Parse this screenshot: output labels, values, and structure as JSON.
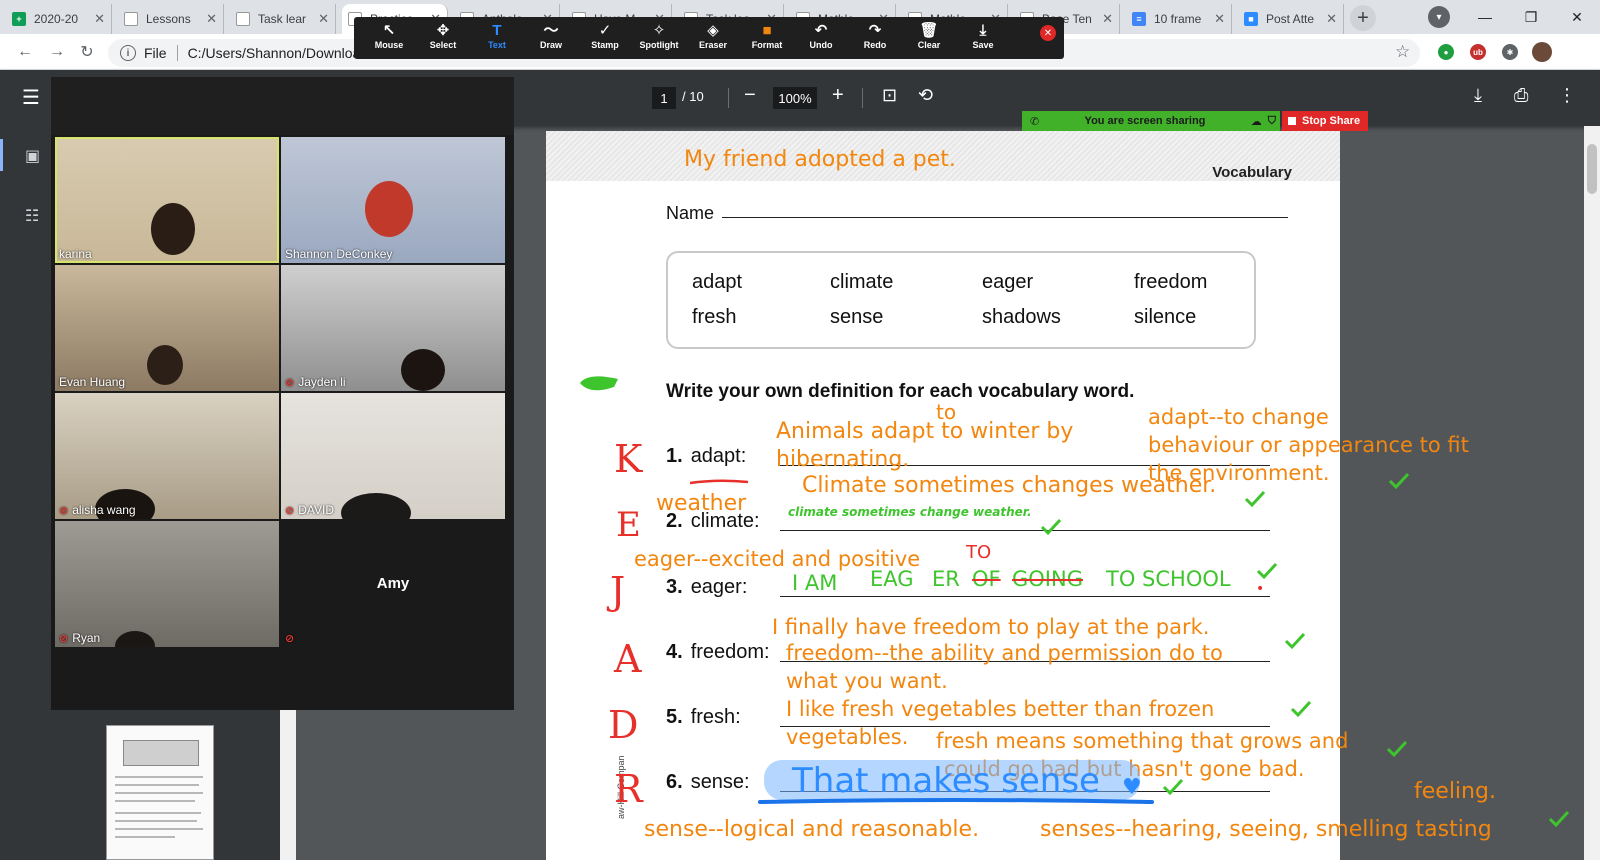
{
  "browser": {
    "tabs": [
      {
        "title": "2020-20",
        "color": "#0f9d58",
        "glyph": "+"
      },
      {
        "title": "Lessons",
        "color": "#ffffff",
        "glyph": ""
      },
      {
        "title": "Task lear",
        "color": "#ffffff",
        "glyph": ""
      },
      {
        "title": "Practice",
        "color": "#ffffff",
        "glyph": ""
      },
      {
        "title": "Antholo",
        "color": "#ffffff",
        "glyph": ""
      },
      {
        "title": "Have M",
        "color": "#ffffff",
        "glyph": ""
      },
      {
        "title": "Task lea",
        "color": "#ffffff",
        "glyph": ""
      },
      {
        "title": "Mathle",
        "color": "#ffffff",
        "glyph": ""
      },
      {
        "title": "Mathle",
        "color": "#ffffff",
        "glyph": ""
      },
      {
        "title": "Base Ten",
        "color": "#ffffff",
        "glyph": ""
      },
      {
        "title": "10 frame",
        "color": "#4285f4",
        "glyph": "≡"
      },
      {
        "title": "Post Atte",
        "color": "#2d8cff",
        "glyph": "■"
      }
    ],
    "address": {
      "scheme": "File",
      "path": "C:/Users/Shannon/Downloads"
    }
  },
  "annotation_toolbar": {
    "tools": [
      {
        "label": "Mouse",
        "icon": "↖",
        "icon_name": "mouse-icon"
      },
      {
        "label": "Select",
        "icon": "✥",
        "icon_name": "select-icon"
      },
      {
        "label": "Text",
        "icon": "T",
        "icon_name": "text-icon"
      },
      {
        "label": "Draw",
        "icon": "〜",
        "icon_name": "draw-icon"
      },
      {
        "label": "Stamp",
        "icon": "✓",
        "icon_name": "stamp-icon"
      },
      {
        "label": "Spotlight",
        "icon": "✧",
        "icon_name": "spotlight-icon"
      },
      {
        "label": "Eraser",
        "icon": "◈",
        "icon_name": "eraser-icon"
      },
      {
        "label": "Format",
        "icon": "■",
        "icon_name": "format-icon"
      },
      {
        "label": "Undo",
        "icon": "↶",
        "icon_name": "undo-icon"
      },
      {
        "label": "Redo",
        "icon": "↷",
        "icon_name": "redo-icon"
      },
      {
        "label": "Clear",
        "icon": "🗑",
        "icon_name": "trash-icon"
      },
      {
        "label": "Save",
        "icon": "⤓",
        "icon_name": "save-icon"
      }
    ],
    "active_tool": "Text",
    "active_color": "#2d8cff",
    "format_color": "#f2860f"
  },
  "pdf_toolbar": {
    "page_current": "1",
    "page_total": "/ 10",
    "zoom": "100%"
  },
  "screen_share": {
    "status": "You are screen sharing",
    "stop_label": "Stop Share"
  },
  "participants": [
    {
      "name": "karina",
      "muted": false,
      "speaking": true
    },
    {
      "name": "Shannon DeConkey",
      "muted": false,
      "speaking": false
    },
    {
      "name": "Evan Huang",
      "muted": false,
      "speaking": false
    },
    {
      "name": "Jayden li",
      "muted": true,
      "speaking": false
    },
    {
      "name": "alisha wang",
      "muted": true,
      "speaking": false
    },
    {
      "name": "DAVID",
      "muted": true,
      "speaking": false
    },
    {
      "name": "Ryan",
      "muted": true,
      "speaking": false
    },
    {
      "name": "",
      "muted": true,
      "speaking": false,
      "center_name": "Amy"
    }
  ],
  "worksheet": {
    "header_label": "Vocabulary",
    "name_label": "Name",
    "word_bank": [
      "adapt",
      "climate",
      "eager",
      "freedom",
      "fresh",
      "sense",
      "shadows",
      "silence"
    ],
    "instruction": "Write your own definition for each vocabulary word.",
    "items": [
      {
        "num": "1.",
        "word": "adapt:"
      },
      {
        "num": "2.",
        "word": "climate:"
      },
      {
        "num": "3.",
        "word": "eager:"
      },
      {
        "num": "4.",
        "word": "freedom:"
      },
      {
        "num": "5.",
        "word": "fresh:"
      },
      {
        "num": "6.",
        "word": "sense:"
      }
    ],
    "copyright": "aw-Hill Compan"
  },
  "annotations": {
    "title_sentence": "My friend adopted a pet.",
    "adapt_to": "to",
    "adapt_sentence_1": "Animals adapt to winter by",
    "adapt_sentence_2": "hibernating.",
    "adapt_def_1": "adapt--to change",
    "adapt_def_2": "behaviour or appearance to fit",
    "adapt_def_3": "the environment.",
    "climate_sentence": "Climate sometimes changes weather.",
    "climate_weather": "weather",
    "climate_green": "climate sometimes change weather.",
    "eager_def": "eager--excited and positive",
    "eager_to": "TO",
    "eager_i_am": "I AM",
    "eager_eag": "EAG",
    "eager_er": "ER",
    "eager_of": "OF",
    "eager_going": "GOING",
    "eager_to_school": "TO SCHOOL",
    "freedom_sentence": "I finally have freedom to play at the park.",
    "freedom_def_1": "freedom--the ability and permission do to",
    "freedom_def_2": "what you want.",
    "fresh_sentence_1": "I like fresh vegetables better than frozen",
    "fresh_sentence_2": "vegetables.",
    "fresh_def_1": "fresh means something that grows and",
    "fresh_def_2": "could go bad but hasn't gone bad.",
    "sense_blue": "That makes sense",
    "sense_feeling": "feeling.",
    "sense_def": "sense--logical and reasonable.",
    "senses_def": "senses--hearing, seeing, smelling tasting",
    "letters": [
      "K",
      "E",
      "J",
      "A",
      "D",
      "R"
    ]
  }
}
